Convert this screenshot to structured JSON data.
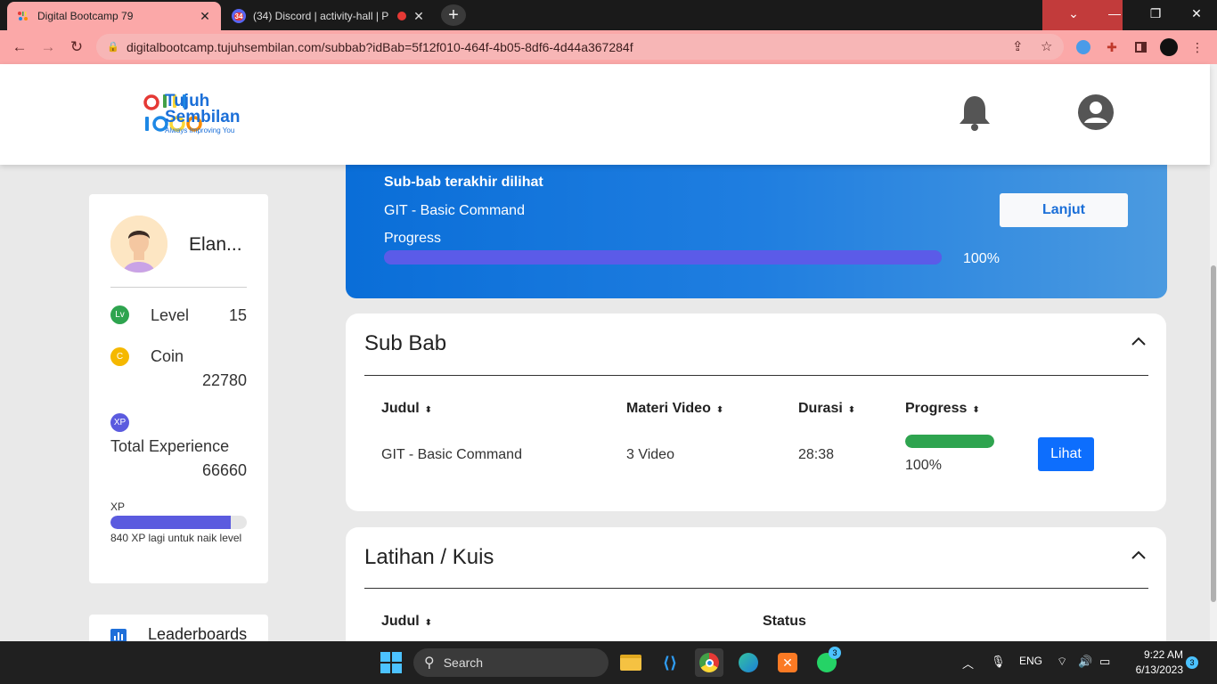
{
  "browser": {
    "tabs": [
      {
        "title": "Digital Bootcamp 79",
        "favicon": "bootcamp-favicon",
        "active": true
      },
      {
        "title": "(34) Discord | activity-hall | P",
        "favicon": "discord-favicon",
        "badge": "34",
        "active": false
      }
    ],
    "url": "digitalbootcamp.tujuhsembilan.com/subbab?idBab=5f12f010-464f-4b05-8df6-4d44a367284f",
    "colors": {
      "frame": "#fba8a8",
      "tabbar": "#1a1a1a"
    }
  },
  "header": {
    "logo_line1": "Tujuh",
    "logo_line2": "Sembilan",
    "logo_tagline": "Always Improving You",
    "bell_icon": "bell-icon",
    "user_icon": "user-circle-icon"
  },
  "profile": {
    "name": "Elan...",
    "level_badge": "Lv",
    "level_label": "Level",
    "level_value": "15",
    "coin_badge": "C",
    "coin_label": "Coin",
    "coin_value": "22780",
    "xp_badge": "XP",
    "experience_label": "Total Experience",
    "experience_value": "66660",
    "xp_bar_label": "XP",
    "xp_progress": 0.88,
    "xp_note": "840 XP lagi untuk naik level"
  },
  "leaderboard": {
    "label": "Leaderboards"
  },
  "last_viewed": {
    "heading": "Sub-bab terakhir dilihat",
    "title": "GIT - Basic Command",
    "progress_label": "Progress",
    "progress": 100,
    "progress_text": "100%",
    "button": "Lanjut"
  },
  "subbab": {
    "title": "Sub Bab",
    "columns": [
      "Judul",
      "Materi Video",
      "Durasi",
      "Progress"
    ],
    "rows": [
      {
        "judul": "GIT - Basic Command",
        "materi": "3 Video",
        "durasi": "28:38",
        "progress": 100,
        "progress_text": "100%",
        "action": "Lihat"
      }
    ]
  },
  "quiz": {
    "title": "Latihan / Kuis",
    "columns": [
      "Judul",
      "Status"
    ]
  },
  "taskbar": {
    "search_placeholder": "Search",
    "whatsapp_badge": "3",
    "language": "ENG",
    "time": "9:22 AM",
    "date": "6/13/2023",
    "notification_count": "3"
  }
}
